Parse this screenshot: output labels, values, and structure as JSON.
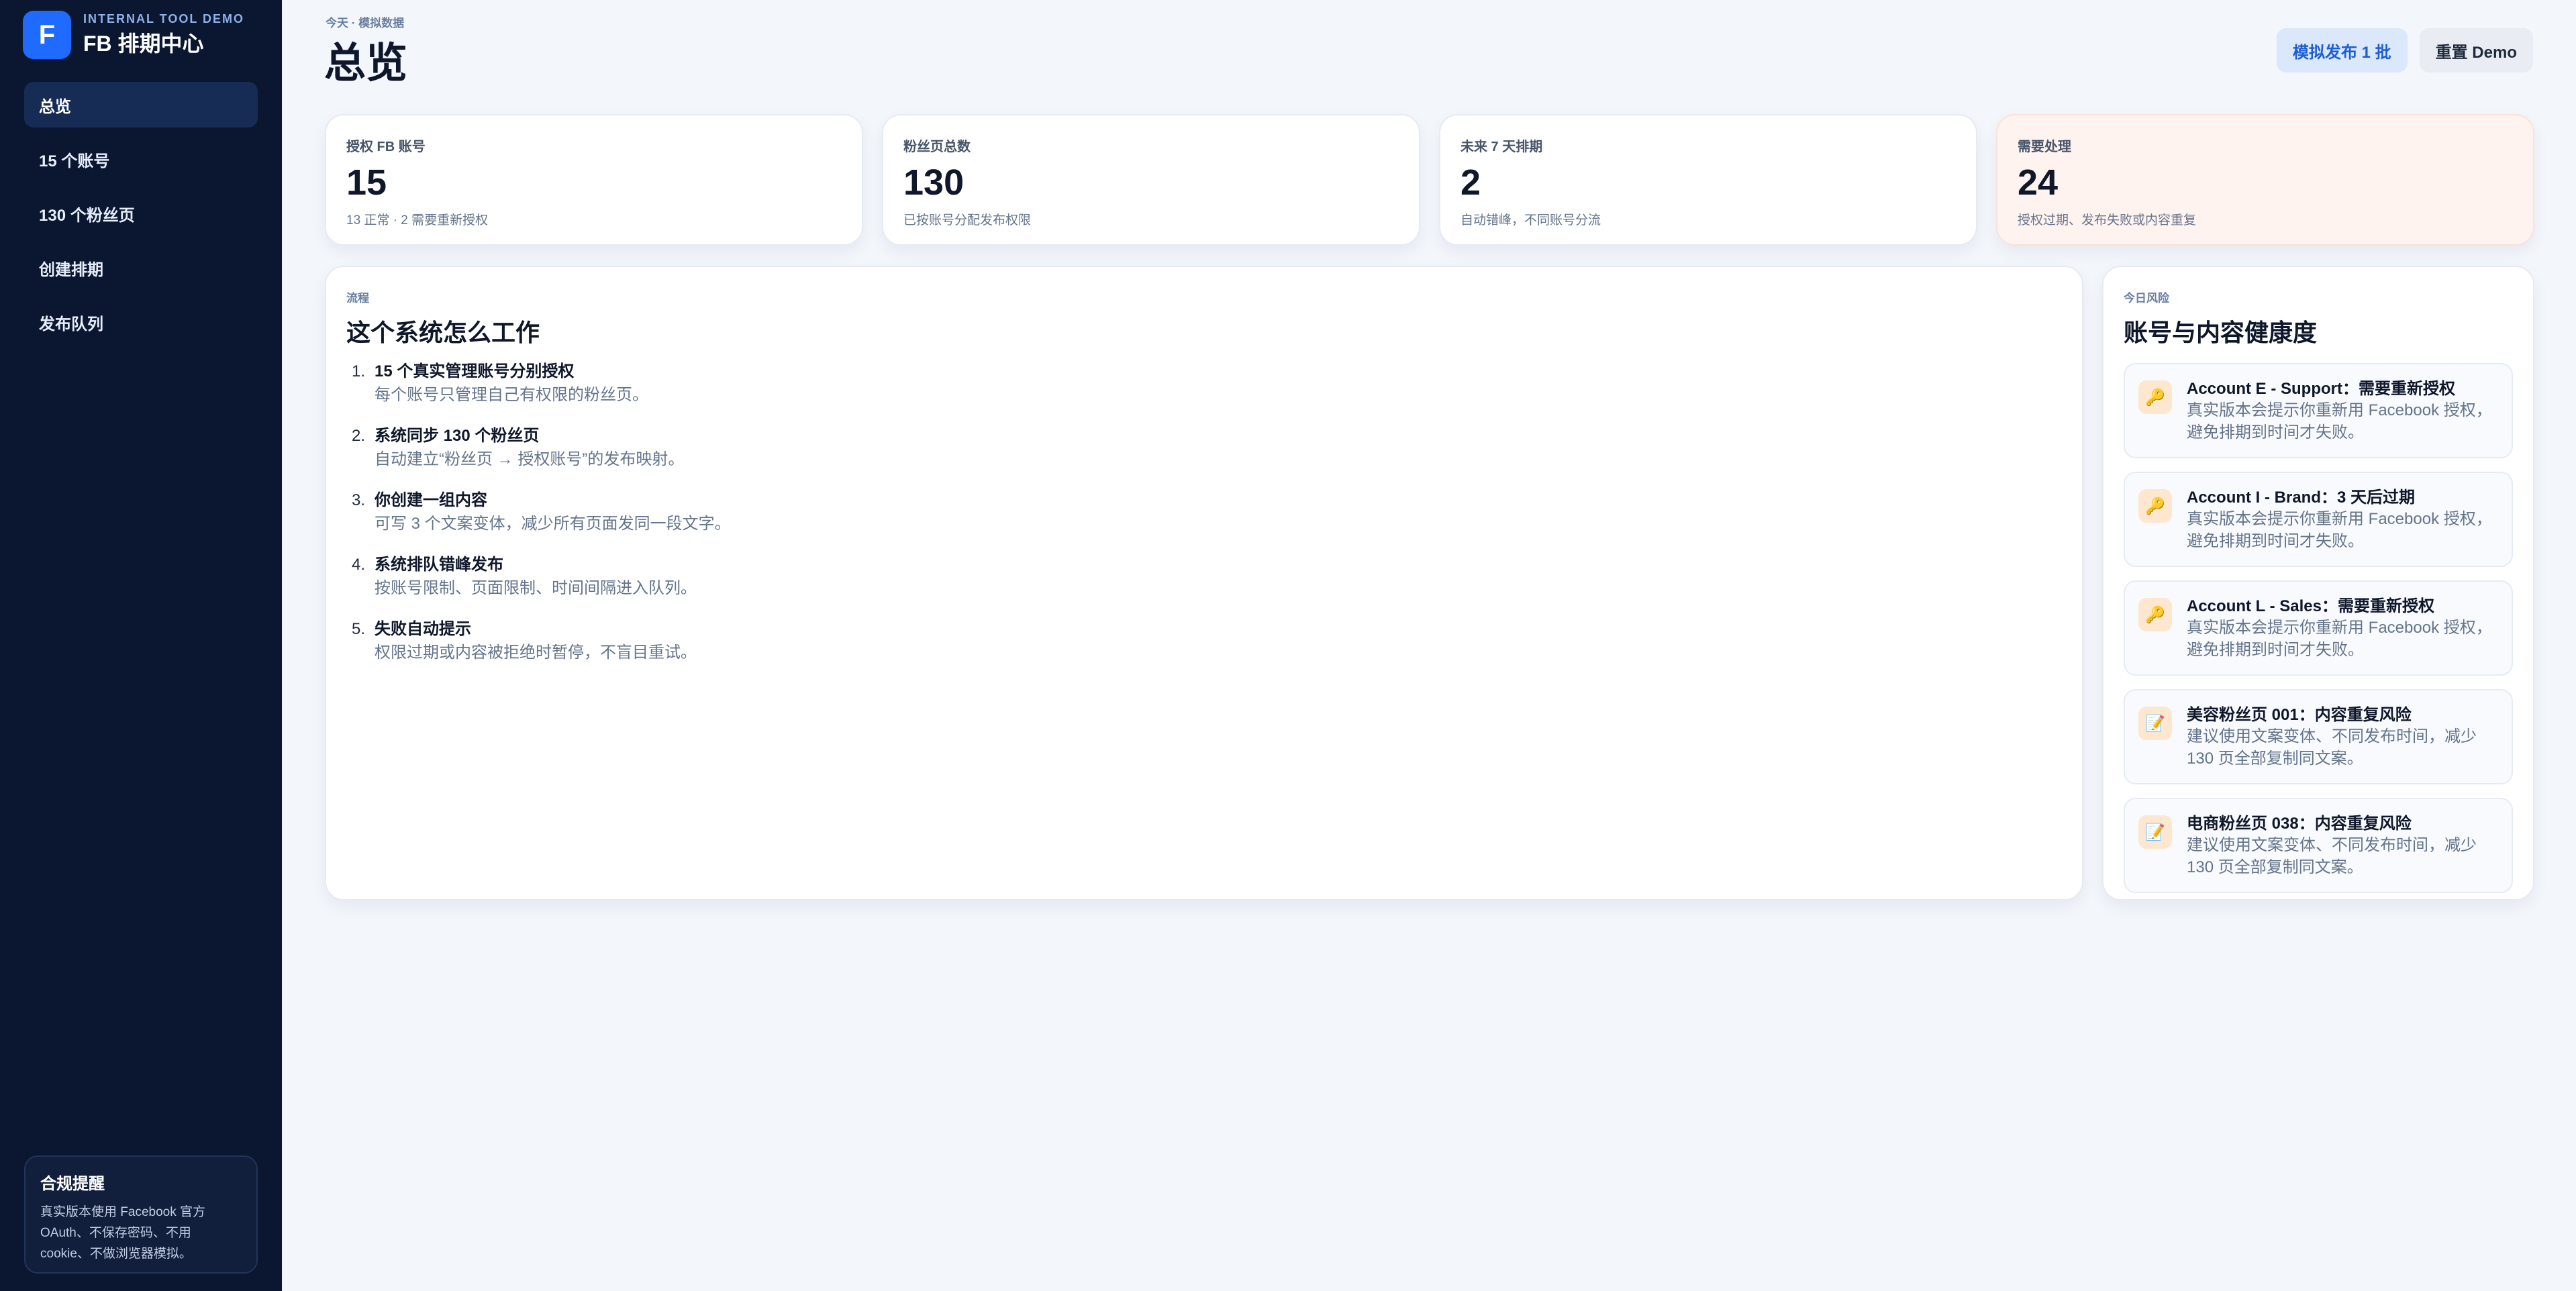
{
  "sidebar": {
    "logo_letter": "F",
    "brand_sub": "INTERNAL TOOL DEMO",
    "brand_title": "FB 排期中心",
    "items": [
      {
        "label": "总览"
      },
      {
        "label": "15 个账号"
      },
      {
        "label": "130 个粉丝页"
      },
      {
        "label": "创建排期"
      },
      {
        "label": "发布队列"
      }
    ],
    "compliance": {
      "title": "合规提醒",
      "text": "真实版本使用 Facebook 官方 OAuth、不保存密码、不用 cookie、不做浏览器模拟。"
    }
  },
  "header": {
    "breadcrumb": "今天 · 模拟数据",
    "title": "总览",
    "primary_button": "模拟发布 1 批",
    "secondary_button": "重置 Demo"
  },
  "stats": [
    {
      "label": "授权 FB 账号",
      "value": "15",
      "note": "13 正常 · 2 需要重新授权"
    },
    {
      "label": "粉丝页总数",
      "value": "130",
      "note": "已按账号分配发布权限"
    },
    {
      "label": "未来 7 天排期",
      "value": "2",
      "note": "自动错峰，不同账号分流"
    },
    {
      "label": "需要处理",
      "value": "24",
      "note": "授权过期、发布失败或内容重复"
    }
  ],
  "process": {
    "kicker": "流程",
    "title": "这个系统怎么工作",
    "steps": [
      {
        "num": "1.",
        "title": "15 个真实管理账号分别授权",
        "desc": "每个账号只管理自己有权限的粉丝页。"
      },
      {
        "num": "2.",
        "title": "系统同步 130 个粉丝页",
        "desc": "自动建立“粉丝页 → 授权账号”的发布映射。"
      },
      {
        "num": "3.",
        "title": "你创建一组内容",
        "desc": "可写 3 个文案变体，减少所有页面发同一段文字。"
      },
      {
        "num": "4.",
        "title": "系统排队错峰发布",
        "desc": "按账号限制、页面限制、时间间隔进入队列。"
      },
      {
        "num": "5.",
        "title": "失败自动提示",
        "desc": "权限过期或内容被拒绝时暂停，不盲目重试。"
      }
    ]
  },
  "health": {
    "kicker": "今日风险",
    "title": "账号与内容健康度",
    "items": [
      {
        "icon": "key-icon",
        "glyph": "🔑",
        "title": "Account E - Support：需要重新授权",
        "desc": "真实版本会提示你重新用 Facebook 授权，避免排期到时间才失败。"
      },
      {
        "icon": "key-icon",
        "glyph": "🔑",
        "title": "Account I - Brand：3 天后过期",
        "desc": "真实版本会提示你重新用 Facebook 授权，避免排期到时间才失败。"
      },
      {
        "icon": "key-icon",
        "glyph": "🔑",
        "title": "Account L - Sales：需要重新授权",
        "desc": "真实版本会提示你重新用 Facebook 授权，避免排期到时间才失败。"
      },
      {
        "icon": "memo-icon",
        "glyph": "📝",
        "title": "美容粉丝页 001：内容重复风险",
        "desc": "建议使用文案变体、不同发布时间，减少 130 页全部复制同文案。"
      },
      {
        "icon": "memo-icon",
        "glyph": "📝",
        "title": "电商粉丝页 038：内容重复风险",
        "desc": "建议使用文案变体、不同发布时间，减少 130 页全部复制同文案。"
      }
    ]
  }
}
